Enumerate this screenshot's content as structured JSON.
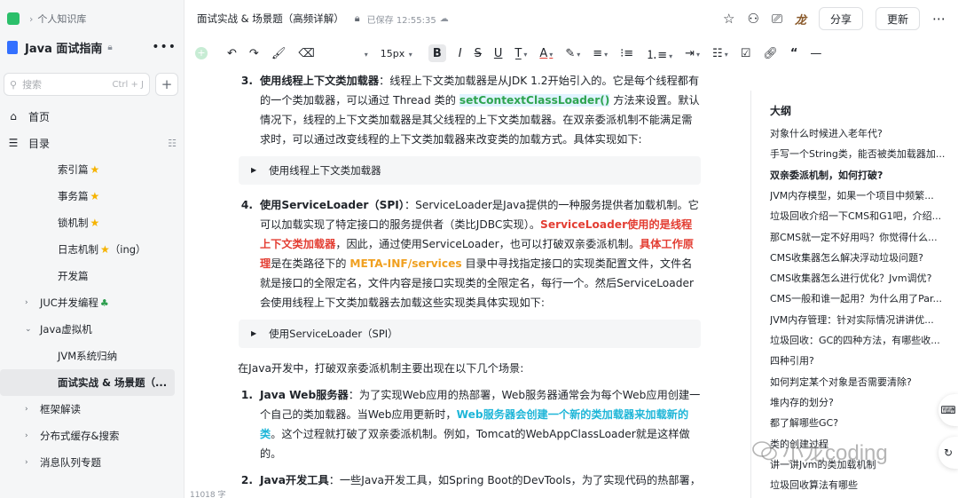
{
  "sidebar": {
    "breadcrumb": "个人知识库",
    "title": "Java 面试指南",
    "search_placeholder": "搜索",
    "search_shortcut": "Ctrl + J",
    "home": "首页",
    "toc": "目录",
    "items": [
      {
        "label": "索引篇",
        "star": true
      },
      {
        "label": "事务篇",
        "star": true
      },
      {
        "label": "锁机制",
        "star": true
      },
      {
        "label": "日志机制",
        "star": true,
        "suffix": "（ing）"
      },
      {
        "label": "开发篇",
        "star": false
      }
    ],
    "groups": [
      {
        "label": "JUC并发编程",
        "emoji": "🌲",
        "expanded": false
      },
      {
        "label": "Java虚拟机",
        "expanded": true
      }
    ],
    "jvm_children": [
      "JVM系统归纳",
      "面试实战 & 场景题（..."
    ],
    "groups_after": [
      "框架解读",
      "分布式缓存&搜索",
      "消息队列专题"
    ]
  },
  "header": {
    "doc_title": "面试实战 & 场景题（高频详解）",
    "saved": "已保存 12:55:35",
    "share": "分享",
    "update": "更新",
    "author_mark": "龙"
  },
  "toolbar": {
    "font_size": "15px"
  },
  "content": {
    "item3": {
      "num": "3.",
      "title": "使用线程上下文类加载器",
      "t1": "：线程上下文类加载器是从JDK 1.2开始引入的。它是每个线程都有的一个类加载器，可以通过 Thread 类的 ",
      "code": "setContextClassLoader()",
      "t2": " 方法来设置。默认情况下，线程的上下文类加载器是其父线程的上下文类加载器。在双亲委派机制不能满足需求时，可以通过改变线程的上下文类加载器来改变类的加载方式。具体实现如下:"
    },
    "toggle1": "使用线程上下文类加载器",
    "item4": {
      "num": "4.",
      "title": "使用ServiceLoader（SPI）",
      "t1": "：ServiceLoader是Java提供的一种服务提供者加载机制。它可以加载实现了特定接口的服务提供者（类比JDBC实现）。",
      "red1": "ServiceLoader使用的是线程上下文类加载器",
      "t2": "，因此，通过使用ServiceLoader，也可以打破双亲委派机制。",
      "red2": "具体工作原理",
      "t3": "是在类路径下的 ",
      "orange": "META-INF/services",
      "t4": " 目录中寻找指定接口的实现类配置文件，文件名就是接口的全限定名，文件内容是接口实现类的全限定名，每行一个。然后ServiceLoader会使用线程上下文类加载器去加载这些实现类具体实现如下:"
    },
    "toggle2": "使用ServiceLoader（SPI）",
    "para": "在Java开发中，打破双亲委派机制主要出现在以下几个场景:",
    "s1": {
      "num": "1.",
      "title": "Java Web服务器",
      "t1": "：为了实现Web应用的热部署，Web服务器通常会为每个Web应用创建一个自己的类加载器。当Web应用更新时，",
      "cyan": "Web服务器会创建一个新的类加载器来加载新的类",
      "t2": "。这个过程就打破了双亲委派机制。例如，Tomcat的WebAppClassLoader就是这样做的。"
    },
    "s2": {
      "num": "2.",
      "title": "Java开发工具",
      "t1": "：一些Java开发工具，如Spring Boot的DevTools，为了实现代码的热部署，也会打破双亲委派机制。DevTools使用了两个类加载器，一个类加载器加载那些不经"
    },
    "word_count": "11018 字"
  },
  "outline": {
    "title": "大纲",
    "items": [
      "对象什么时候进入老年代?",
      "手写一个String类，能否被类加载器加...",
      "双亲委派机制，如何打破?",
      "JVM内存模型，如果一个项目中频繁...",
      "垃圾回收介绍一下CMS和G1吧，介绍...",
      "那CMS就一定不好用吗？你觉得什么...",
      "CMS收集器怎么解决浮动垃圾问题?",
      "CMS收集器怎么进行优化？Jvm调优?",
      "CMS一般和谁一起用？为什么用了Par...",
      "JVM内存管理：针对实际情况讲讲优...",
      "垃圾回收：GC的四种方法，有哪些收...",
      "四种引用?",
      "如何判定某个对象是否需要清除?",
      "堆内存的划分?",
      "都了解哪些GC?",
      "类的创建过程",
      "讲一讲Jvm的类加载机制",
      "垃圾回收算法有哪些"
    ],
    "current_index": 2
  },
  "watermark": "小龙coding"
}
